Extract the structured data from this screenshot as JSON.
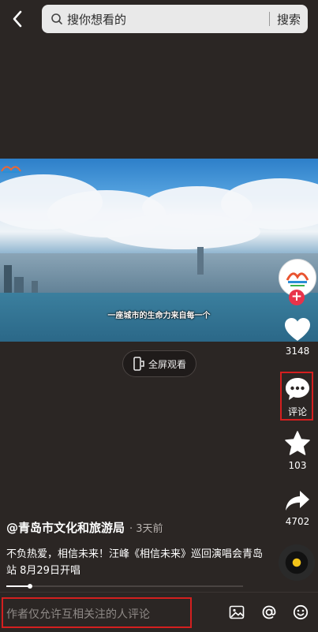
{
  "search": {
    "placeholder": "搜你想看的",
    "button": "搜索"
  },
  "video": {
    "subtitle": "一座城市的生命力来自每一个"
  },
  "fullscreen": {
    "label": "全屏观看"
  },
  "actions": {
    "likes": "3148",
    "comment_label": "评论",
    "favorites": "103",
    "shares": "4702"
  },
  "post": {
    "author": "@青岛市文化和旅游局",
    "time": "· 3天前",
    "description": "不负热爱，相信未来！汪峰《相信未来》巡回演唱会青岛站 8月29日开唱"
  },
  "playback": {
    "progress": 0.1
  },
  "comment_bar": {
    "placeholder": "作者仅允许互相关注的人评论"
  },
  "colors": {
    "background": "#2b2624",
    "follow": "#e8334a",
    "highlight": "#d41f1f",
    "disc_center": "#f3c419"
  },
  "icons": [
    "back-icon",
    "search-icon",
    "fullscreen-icon",
    "heart-icon",
    "comment-icon",
    "star-icon",
    "share-icon",
    "image-icon",
    "at-icon",
    "emoji-icon",
    "music-disc-icon"
  ]
}
